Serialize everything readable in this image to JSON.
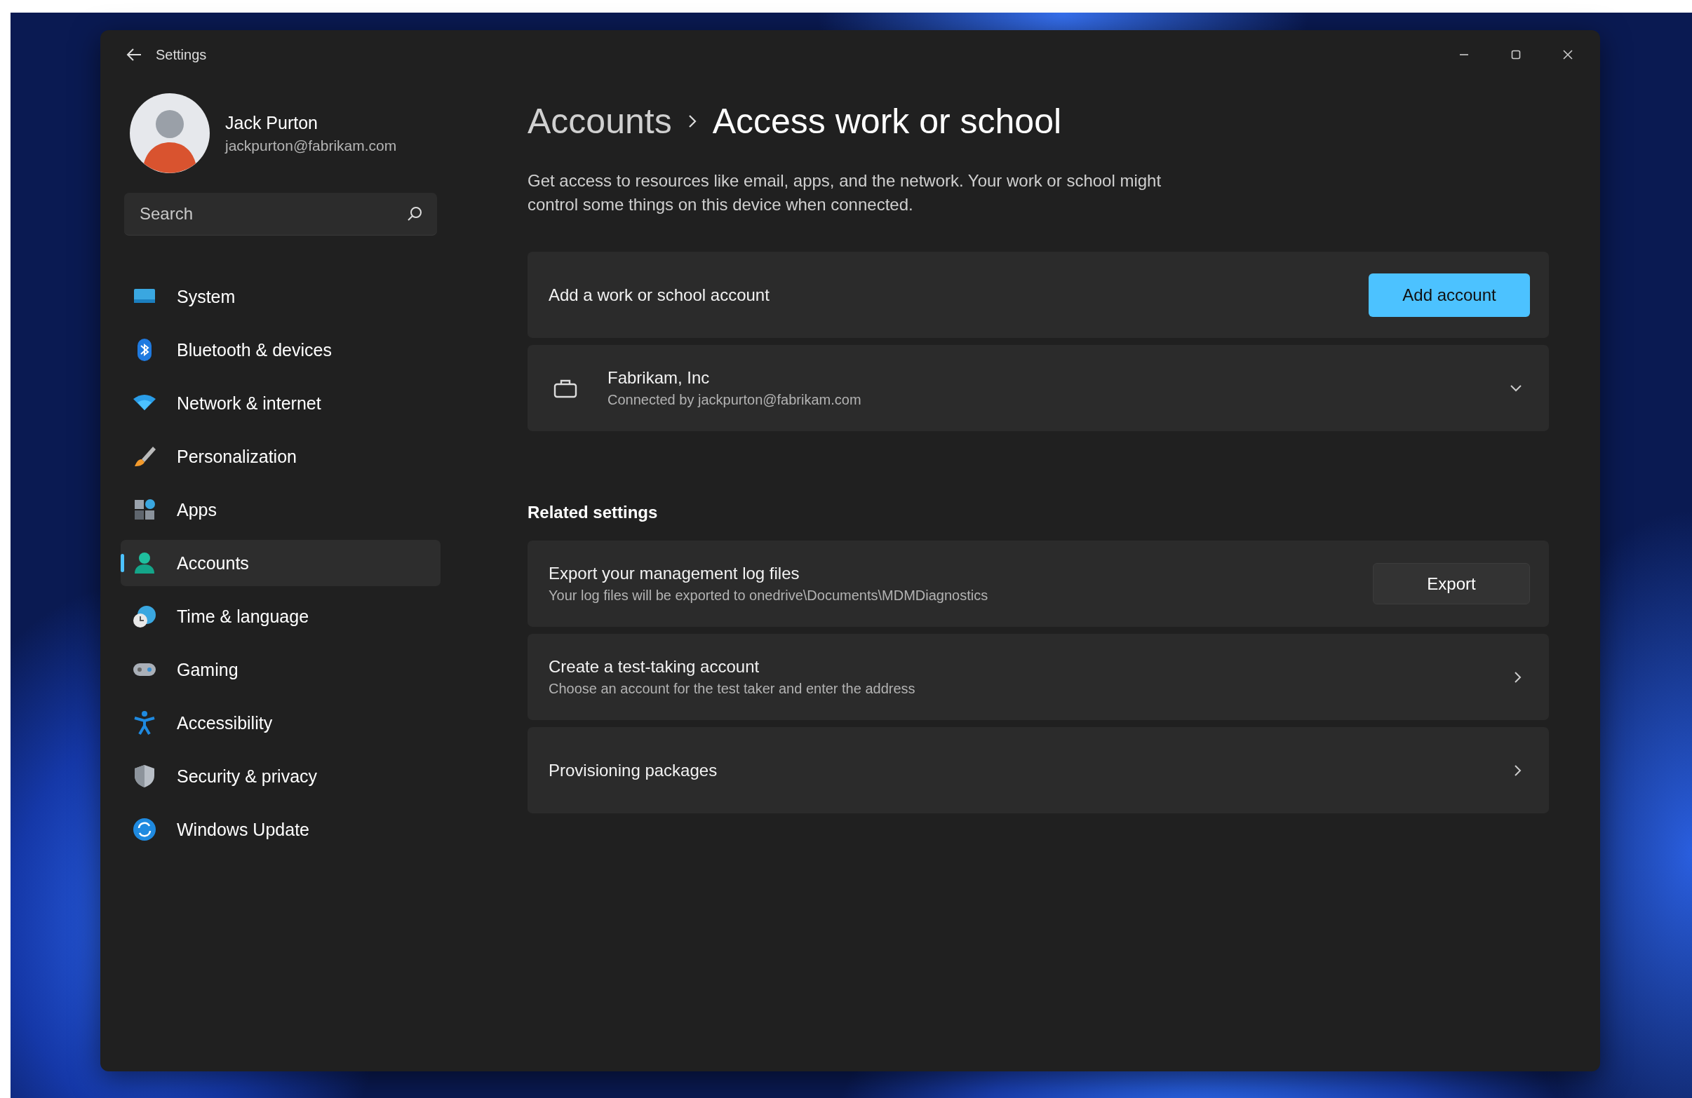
{
  "window": {
    "title": "Settings"
  },
  "user": {
    "name": "Jack Purton",
    "email": "jackpurton@fabrikam.com"
  },
  "search": {
    "placeholder": "Search"
  },
  "nav": [
    {
      "label": "System",
      "selected": false
    },
    {
      "label": "Bluetooth & devices",
      "selected": false
    },
    {
      "label": "Network & internet",
      "selected": false
    },
    {
      "label": "Personalization",
      "selected": false
    },
    {
      "label": "Apps",
      "selected": false
    },
    {
      "label": "Accounts",
      "selected": true
    },
    {
      "label": "Time & language",
      "selected": false
    },
    {
      "label": "Gaming",
      "selected": false
    },
    {
      "label": "Accessibility",
      "selected": false
    },
    {
      "label": "Security & privacy",
      "selected": false
    },
    {
      "label": "Windows Update",
      "selected": false
    }
  ],
  "breadcrumb": {
    "parent": "Accounts",
    "current": "Access work or school"
  },
  "description": "Get access to resources like email, apps, and the network. Your work or school might control some things on this device when connected.",
  "account_cards": [
    {
      "kind": "action",
      "title": "Add a work or school account",
      "button": "Add account"
    },
    {
      "kind": "account",
      "title": "Fabrikam, Inc",
      "subtitle": "Connected by jackpurton@fabrikam.com",
      "expanded": false
    }
  ],
  "related_settings": {
    "heading": "Related settings",
    "items": [
      {
        "kind": "button",
        "title": "Export your management log files",
        "subtitle": "Your log files will be exported to onedrive\\Documents\\MDMDiagnostics",
        "button": "Export"
      },
      {
        "kind": "link",
        "title": "Create a test-taking account",
        "subtitle": "Choose an account for the test taker and enter the address"
      },
      {
        "kind": "link",
        "title": "Provisioning packages"
      }
    ]
  }
}
